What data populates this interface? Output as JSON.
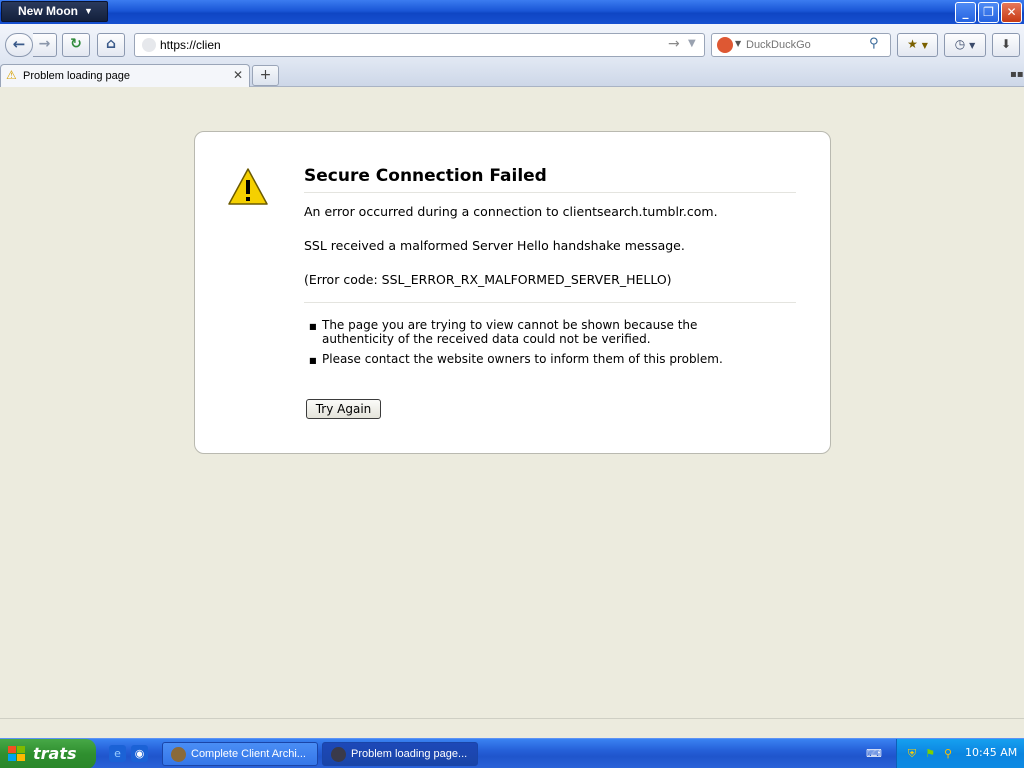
{
  "titlebar": {
    "app_menu_label": "New Moon",
    "minimize_glyph": "_",
    "maximize_glyph": "❐",
    "close_glyph": "✕"
  },
  "navbar": {
    "back_glyph": "←",
    "forward_glyph": "→",
    "reload_glyph": "↻",
    "home_glyph": "⌂",
    "url_value": "https://clien",
    "go_glyph": "→",
    "url_dropdown_glyph": "▼",
    "search_engine": "DuckDuckGo",
    "search_placeholder": "DuckDuckGo",
    "search_glyph": "⚲",
    "bookmarks_glyph": "★",
    "history_glyph": "◷",
    "downloads_glyph": "⬇"
  },
  "tabs": {
    "items": [
      {
        "label": "Problem loading page",
        "icon": "warning-icon"
      }
    ],
    "close_glyph": "✕",
    "new_tab_glyph": "+",
    "tab_list_glyph": "▪▪"
  },
  "error_page": {
    "title": "Secure Connection Failed",
    "message": "An error occurred during a connection to clientsearch.tumblr.com.",
    "detail": "SSL received a malformed Server Hello handshake message.",
    "error_code": "(Error code: SSL_ERROR_RX_MALFORMED_SERVER_HELLO)",
    "bullets": [
      "The page you are trying to view cannot be shown because the authenticity of the received data could not be verified.",
      "Please contact the website owners to inform them of this problem."
    ],
    "try_again_label": "Try Again"
  },
  "taskbar": {
    "start_label": "trats",
    "tasks": [
      {
        "label": "Complete Client Archi...",
        "active": false
      },
      {
        "label": "Problem loading page...",
        "active": true
      }
    ],
    "clock": "10:45 AM"
  },
  "colors": {
    "page_background": "#ecebde",
    "titlebar_blue": "#1a56d6",
    "warning_yellow": "#f5d000",
    "start_green": "#3a9a3a"
  }
}
